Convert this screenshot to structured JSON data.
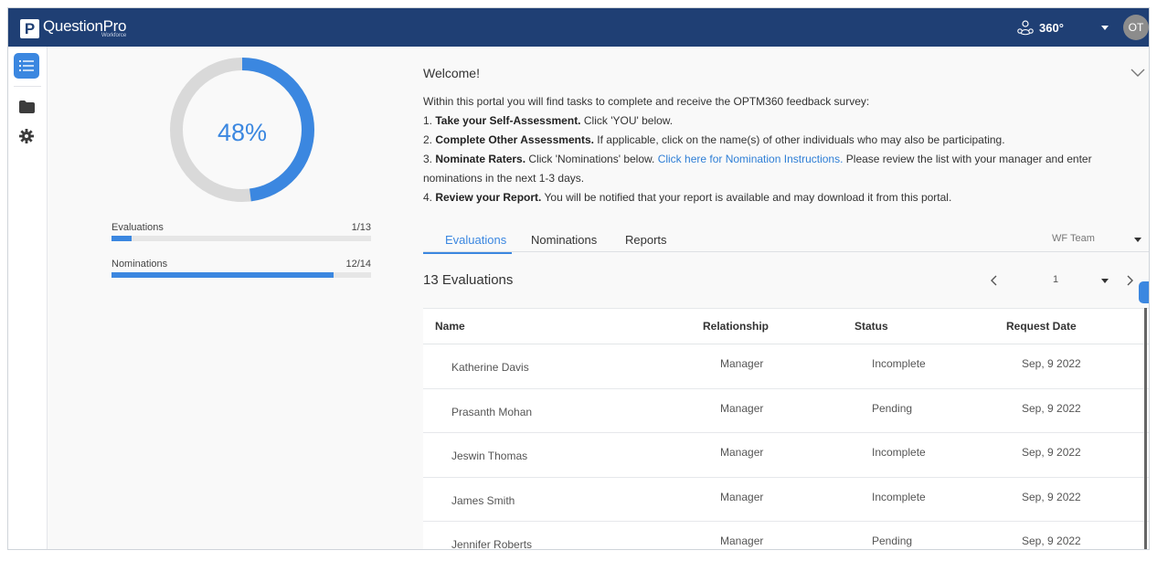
{
  "header": {
    "logo_name": "QuestionPro",
    "logo_sub": "Workforce",
    "logo_letter": "P",
    "product": "360°",
    "avatar": "OT"
  },
  "sidebar": {
    "items": [
      {
        "icon": "list-icon",
        "active": true
      },
      {
        "icon": "folder-icon",
        "active": false
      },
      {
        "icon": "gear-icon",
        "active": false
      }
    ]
  },
  "progress": {
    "percent_label": "48%",
    "percent": 48,
    "evaluations_label": "Evaluations",
    "evaluations_value": "1/13",
    "evaluations_fraction": 0.077,
    "nominations_label": "Nominations",
    "nominations_value": "12/14",
    "nominations_fraction": 0.857
  },
  "welcome": {
    "title": "Welcome!",
    "intro": "Within this portal you will find tasks to complete and receive the OPTM360 feedback survey:",
    "step1_bold": "Take your Self-Assessment.",
    "step1_text": " Click 'YOU' below.",
    "step2_bold": "Complete Other Assessments.",
    "step2_text": " If applicable, click on the name(s) of other individuals who may also be participating.",
    "step3_bold": "Nominate Raters.",
    "step3_text": " Click 'Nominations' below. ",
    "step3_link": "Click here for Nomination Instructions.",
    "step3_text2": " Please review the list with your manager and enter nominations in the next 1-3 days.",
    "step4_bold": "Review your Report.",
    "step4_text": " You will be notified that your report is available and may download it from this portal."
  },
  "tabs": [
    "Evaluations",
    "Nominations",
    "Reports"
  ],
  "team_filter": "WF Team",
  "list": {
    "count_label": "13 Evaluations",
    "page": "1"
  },
  "table": {
    "columns": [
      "Name",
      "Relationship",
      "Status",
      "Request Date"
    ],
    "rows": [
      {
        "name": "Katherine Davis",
        "relationship": "Manager",
        "status": "Incomplete",
        "date": "Sep, 9 2022"
      },
      {
        "name": "Prasanth Mohan",
        "relationship": "Manager",
        "status": "Pending",
        "date": "Sep, 9 2022"
      },
      {
        "name": "Jeswin Thomas",
        "relationship": "Manager",
        "status": "Incomplete",
        "date": "Sep, 9 2022"
      },
      {
        "name": "James Smith",
        "relationship": "Manager",
        "status": "Incomplete",
        "date": "Sep, 9 2022"
      },
      {
        "name": "Jennifer Roberts",
        "relationship": "Manager",
        "status": "Pending",
        "date": "Sep, 9 2022"
      }
    ]
  },
  "colors": {
    "brand": "#1f3f74",
    "accent": "#3b87e0",
    "track": "#d9d9d9"
  }
}
